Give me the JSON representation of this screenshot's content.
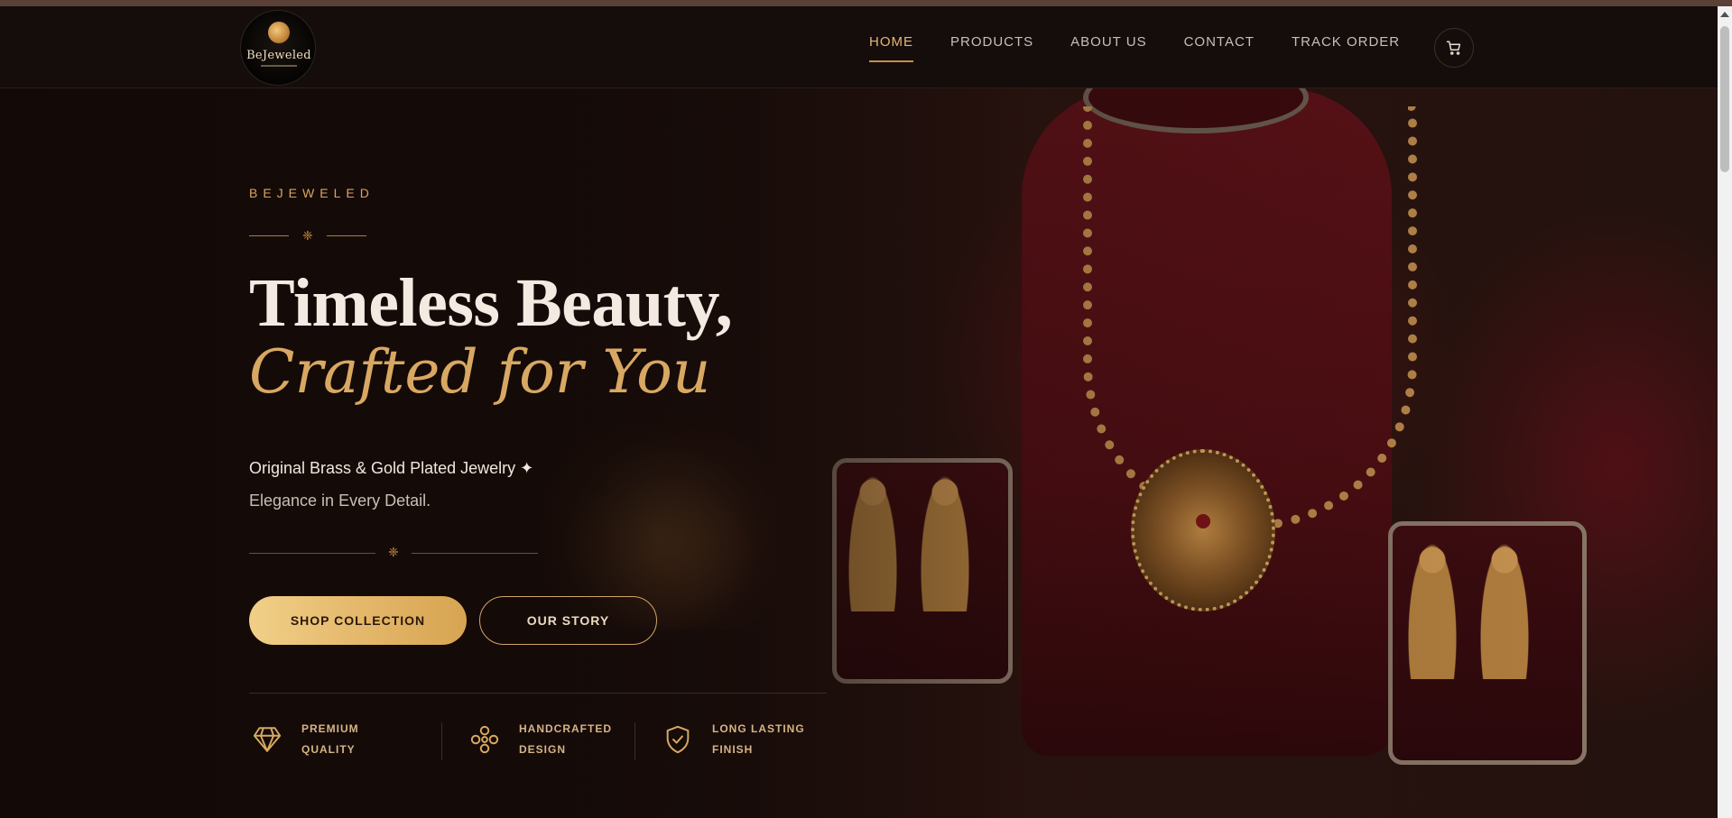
{
  "header": {
    "logo_text": "BeJeweled",
    "nav": [
      {
        "label": "HOME",
        "active": true
      },
      {
        "label": "PRODUCTS",
        "active": false
      },
      {
        "label": "ABOUT US",
        "active": false
      },
      {
        "label": "CONTACT",
        "active": false
      },
      {
        "label": "TRACK ORDER",
        "active": false
      }
    ],
    "cart_icon": "cart-icon"
  },
  "hero": {
    "kicker": "BEJEWELED",
    "headline": "Timeless Beauty,",
    "headline_accent": "Crafted for You",
    "tagline": "Original Brass & Gold Plated Jewelry ✦",
    "tagline_2": "Elegance in Every Detail.",
    "buttons": {
      "primary": "SHOP COLLECTION",
      "secondary": "OUR STORY"
    },
    "features": [
      {
        "icon": "diamond-icon",
        "line1": "PREMIUM",
        "line2": "QUALITY"
      },
      {
        "icon": "knot-icon",
        "line1": "HANDCRAFTED",
        "line2": "DESIGN"
      },
      {
        "icon": "shield-check-icon",
        "line1": "LONG LASTING",
        "line2": "FINISH"
      }
    ]
  },
  "colors": {
    "accent_gold": "#d8a862",
    "background": "#140c0a",
    "velvet": "#5a1117"
  }
}
